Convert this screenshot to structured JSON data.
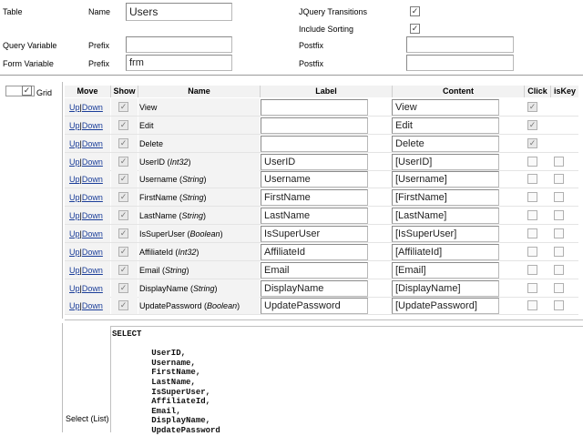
{
  "top": {
    "table_label": "Table",
    "name_label": "Name",
    "name_value": "Users",
    "jquery_label": "JQuery Transitions",
    "sorting_label": "Include Sorting",
    "query_variable_label": "Query Variable",
    "form_variable_label": "Form Variable",
    "prefix_label": "Prefix",
    "postfix_label": "Postfix",
    "query_prefix_value": "",
    "query_postfix_value": "",
    "form_prefix_value": "frm",
    "form_postfix_value": ""
  },
  "grid": {
    "toggle_label": "Grid",
    "headers": {
      "move": "Move",
      "show": "Show",
      "name": "Name",
      "label": "Label",
      "content": "Content",
      "click": "Click",
      "iskey": "isKey"
    },
    "up": "Up",
    "sep": "|",
    "down": "Down",
    "rows": [
      {
        "name": "View",
        "type": "",
        "label": "",
        "content": "View"
      },
      {
        "name": "Edit",
        "type": "",
        "label": "",
        "content": "Edit"
      },
      {
        "name": "Delete",
        "type": "",
        "label": "",
        "content": "Delete"
      },
      {
        "name": "UserID",
        "type": "Int32",
        "label": "UserID",
        "content": "[UserID]"
      },
      {
        "name": "Username",
        "type": "String",
        "label": "Username",
        "content": "[Username]"
      },
      {
        "name": "FirstName",
        "type": "String",
        "label": "FirstName",
        "content": "[FirstName]"
      },
      {
        "name": "LastName",
        "type": "String",
        "label": "LastName",
        "content": "[LastName]"
      },
      {
        "name": "IsSuperUser",
        "type": "Boolean",
        "label": "IsSuperUser",
        "content": "[IsSuperUser]"
      },
      {
        "name": "AffiliateId",
        "type": "Int32",
        "label": "AffiliateId",
        "content": "[AffiliateId]"
      },
      {
        "name": "Email",
        "type": "String",
        "label": "Email",
        "content": "[Email]"
      },
      {
        "name": "DisplayName",
        "type": "String",
        "label": "DisplayName",
        "content": "[DisplayName]"
      },
      {
        "name": "UpdatePassword",
        "type": "Boolean",
        "label": "UpdatePassword",
        "content": "[UpdatePassword]"
      }
    ]
  },
  "select_list": {
    "label": "Select (List)",
    "sql": "SELECT\n\n        UserID,\n        Username,\n        FirstName,\n        LastName,\n        IsSuperUser,\n        AffiliateId,\n        Email,\n        DisplayName,\n        UpdatePassword"
  },
  "colors": {
    "link": "#1a3d99",
    "header_bg": "#f2f2f2",
    "row_bg": "#f3f3f3"
  }
}
